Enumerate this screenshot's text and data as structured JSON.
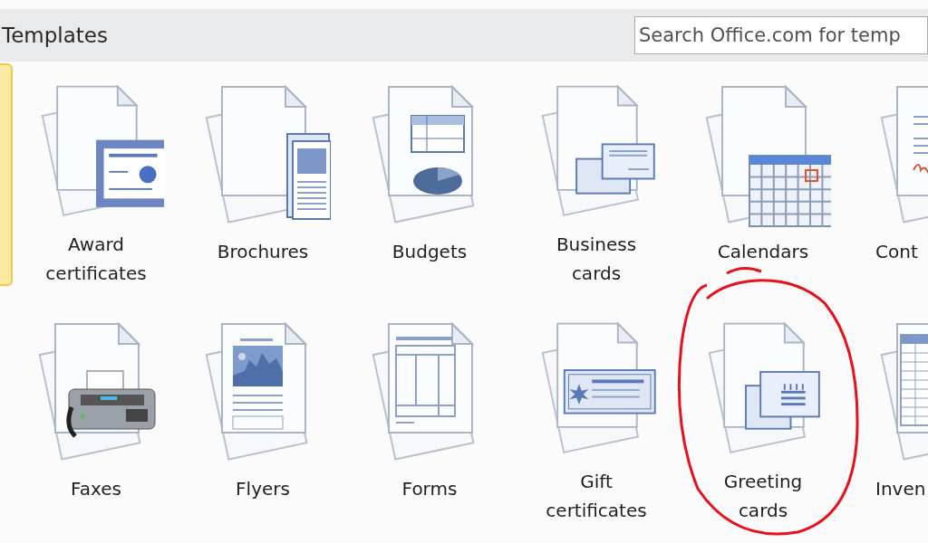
{
  "header": {
    "title": "Templates",
    "search": {
      "placeholder": "Search Office.com for temp"
    }
  },
  "rows": [
    {
      "edge_tile": {
        "selected": true
      },
      "tiles": [
        {
          "label": "Award certificates",
          "kind": "certificate"
        },
        {
          "label": "Brochures",
          "kind": "brochure"
        },
        {
          "label": "Budgets",
          "kind": "budget"
        },
        {
          "label": "Business cards",
          "kind": "business-card"
        },
        {
          "label": "Calendars",
          "kind": "calendar"
        },
        {
          "label": "Cont",
          "kind": "contract"
        }
      ]
    },
    {
      "tiles": [
        {
          "label": "Faxes",
          "kind": "fax"
        },
        {
          "label": "Flyers",
          "kind": "flyer"
        },
        {
          "label": "Forms",
          "kind": "form"
        },
        {
          "label": "Gift certificates",
          "kind": "gift"
        },
        {
          "label": "Greeting cards",
          "kind": "greeting"
        },
        {
          "label": "Inven",
          "kind": "inventory"
        }
      ]
    }
  ]
}
